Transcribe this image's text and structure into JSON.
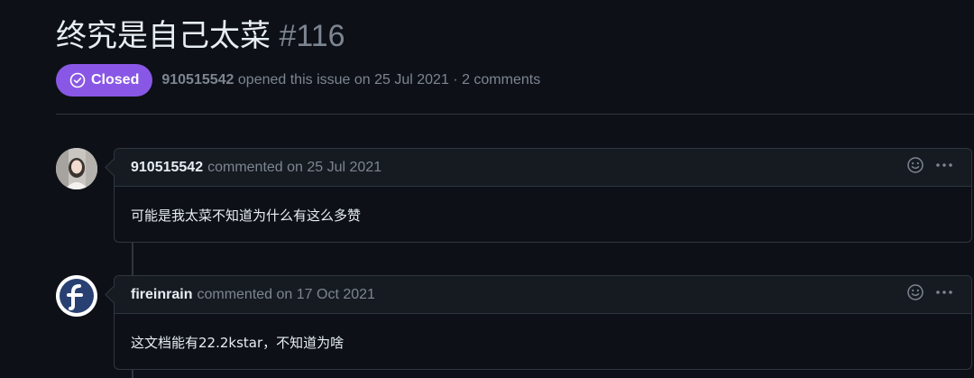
{
  "issue": {
    "title": "终究是自己太菜",
    "number": "#116",
    "status": "Closed",
    "opened_by": "910515542",
    "opened_text": "opened this issue on 25 Jul 2021 · 2 comments"
  },
  "comments": [
    {
      "author": "910515542",
      "meta": "commented on 25 Jul 2021",
      "body": "可能是我太菜不知道为什么有这么多赞",
      "avatar": "photo-avatar"
    },
    {
      "author": "fireinrain",
      "meta": "commented on 17 Oct 2021",
      "body": "这文档能有22.2kstar，不知道为啥",
      "avatar": "fedora-logo-avatar"
    }
  ],
  "icons": {
    "status": "check-circle-icon",
    "reaction": "smiley-icon",
    "more": "kebab-menu-icon"
  },
  "colors": {
    "background": "#0d1117",
    "closed_badge": "#8957e5",
    "border": "#30363d",
    "muted_text": "#7d8590",
    "header_bg": "#161b22"
  }
}
